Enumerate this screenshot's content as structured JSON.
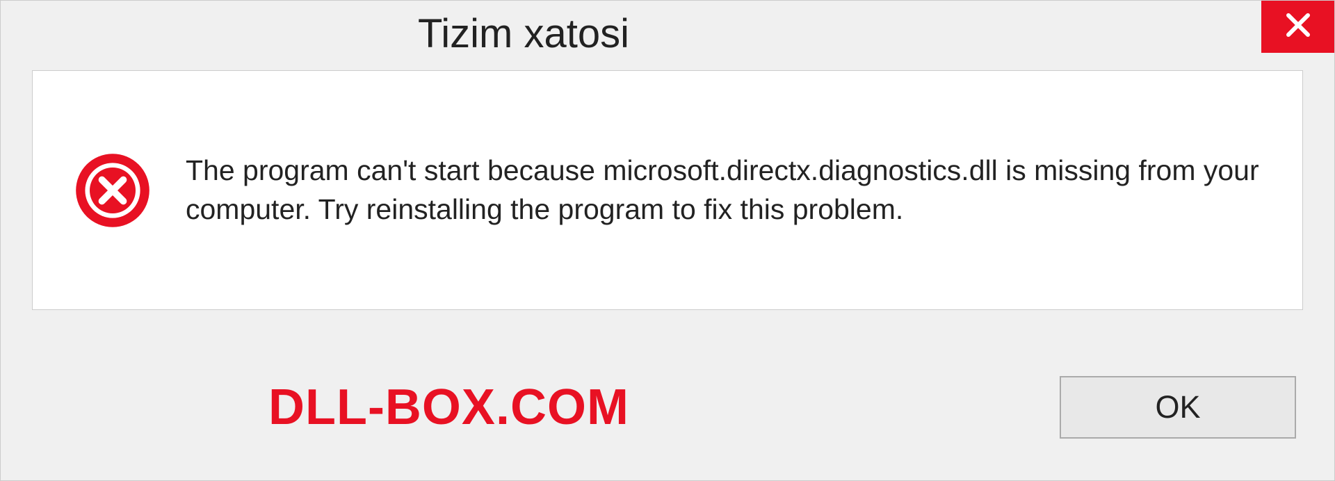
{
  "dialog": {
    "title": "Tizim xatosi",
    "message": "The program can't start because microsoft.directx.diagnostics.dll is missing from your computer. Try reinstalling the program to fix this problem.",
    "ok_label": "OK"
  },
  "watermark": "DLL-BOX.COM",
  "colors": {
    "accent_red": "#e81123",
    "background": "#f0f0f0",
    "panel": "#ffffff"
  }
}
